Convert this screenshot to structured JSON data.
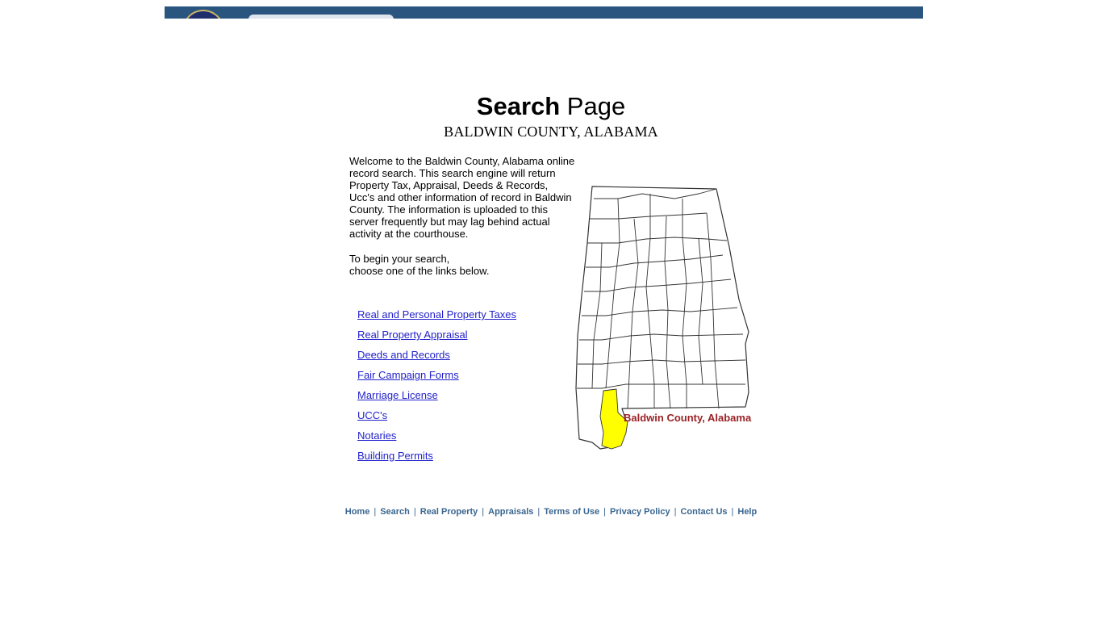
{
  "header": {
    "seal_icon": "county-seal"
  },
  "page": {
    "title_bold": "Search",
    "title_rest": " Page",
    "subtitle": "BALDWIN COUNTY, ALABAMA"
  },
  "intro": {
    "paragraph1": "Welcome to the Baldwin County, Alabama online record search. This search engine will return Property Tax, Appraisal, Deeds & Records, Ucc's and other information of record in Baldwin County. The information is uploaded to this server frequently but may lag behind actual activity at the courthouse.",
    "paragraph2_line1": "To begin your search,",
    "paragraph2_line2": "choose one of the links below."
  },
  "links": [
    {
      "label": "Real and Personal Property Taxes"
    },
    {
      "label": "Real Property Appraisal"
    },
    {
      "label": "Deeds and Records"
    },
    {
      "label": "Fair Campaign Forms"
    },
    {
      "label": "Marriage License"
    },
    {
      "label": "UCC's"
    },
    {
      "label": "Notaries"
    },
    {
      "label": "Building Permits"
    }
  ],
  "map": {
    "label": "Baldwin County, Alabama",
    "highlight_color": "#ffff00",
    "label_color": "#9b2226"
  },
  "footer": {
    "links": [
      {
        "label": "Home"
      },
      {
        "label": "Search"
      },
      {
        "label": "Real Property"
      },
      {
        "label": "Appraisals"
      },
      {
        "label": "Terms of Use"
      },
      {
        "label": "Privacy Policy"
      },
      {
        "label": "Contact Us"
      },
      {
        "label": "Help"
      }
    ],
    "separator": "|"
  }
}
